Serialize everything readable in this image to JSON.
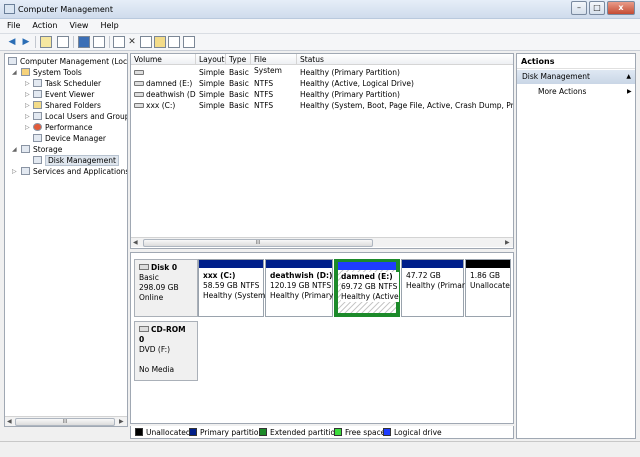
{
  "window": {
    "title": "Computer Management",
    "min": "–",
    "max": "□",
    "close": "x"
  },
  "menu": [
    "File",
    "Action",
    "View",
    "Help"
  ],
  "toolbar": {
    "back": "◀",
    "forward": "▶",
    "delete": "✕"
  },
  "tree": {
    "root": "Computer Management (Local",
    "system_tools": "System Tools",
    "task_scheduler": "Task Scheduler",
    "event_viewer": "Event Viewer",
    "shared_folders": "Shared Folders",
    "local_users": "Local Users and Groups",
    "performance": "Performance",
    "device_manager": "Device Manager",
    "storage": "Storage",
    "disk_management": "Disk Management",
    "services": "Services and Applications",
    "scroll_thumb": "III"
  },
  "volumes": {
    "headers": [
      "Volume",
      "Layout",
      "Type",
      "File System",
      "Status"
    ],
    "rows": [
      {
        "volume": "",
        "layout": "Simple",
        "type": "Basic",
        "fs": "",
        "status": "Healthy (Primary Partition)"
      },
      {
        "volume": "damned (E:)",
        "layout": "Simple",
        "type": "Basic",
        "fs": "NTFS",
        "status": "Healthy (Active, Logical Drive)"
      },
      {
        "volume": "deathwish (D:)",
        "layout": "Simple",
        "type": "Basic",
        "fs": "NTFS",
        "status": "Healthy (Primary Partition)"
      },
      {
        "volume": "xxx (C:)",
        "layout": "Simple",
        "type": "Basic",
        "fs": "NTFS",
        "status": "Healthy (System, Boot, Page File, Active, Crash Dump, Primary"
      }
    ],
    "scroll_thumb": "III"
  },
  "disks": {
    "disk0": {
      "name": "Disk 0",
      "type": "Basic",
      "size": "298.09 GB",
      "status": "Online"
    },
    "partitions": [
      {
        "name": "xxx  (C:)",
        "size": "58.59 GB NTFS",
        "status": "Healthy (System",
        "bar": "#001f8a"
      },
      {
        "name": "deathwish  (D:)",
        "size": "120.19 GB NTFS",
        "status": "Healthy (Primary",
        "bar": "#001f8a"
      },
      {
        "name": "damned  (E:)",
        "size": "69.72 GB NTFS",
        "status": "Healthy (Active",
        "bar": "#1e3cff"
      },
      {
        "name": "",
        "size": "47.72 GB",
        "status": "Healthy (Primar",
        "bar": "#001f8a"
      },
      {
        "name": "",
        "size": "1.86 GB",
        "status": "Unallocate",
        "bar": "#000000"
      }
    ],
    "cdrom": {
      "name": "CD-ROM 0",
      "type": "DVD (F:)",
      "status": "No Media"
    }
  },
  "legend": [
    {
      "label": "Unallocated",
      "color": "#000000"
    },
    {
      "label": "Primary partition",
      "color": "#001f8a"
    },
    {
      "label": "Extended partition",
      "color": "#1c8a2a"
    },
    {
      "label": "Free space",
      "color": "#3cdc3c"
    },
    {
      "label": "Logical drive",
      "color": "#1e3cff"
    }
  ],
  "actions": {
    "title": "Actions",
    "section": "Disk Management",
    "more": "More Actions",
    "more_arrow": "▶",
    "collapse": "▲"
  }
}
